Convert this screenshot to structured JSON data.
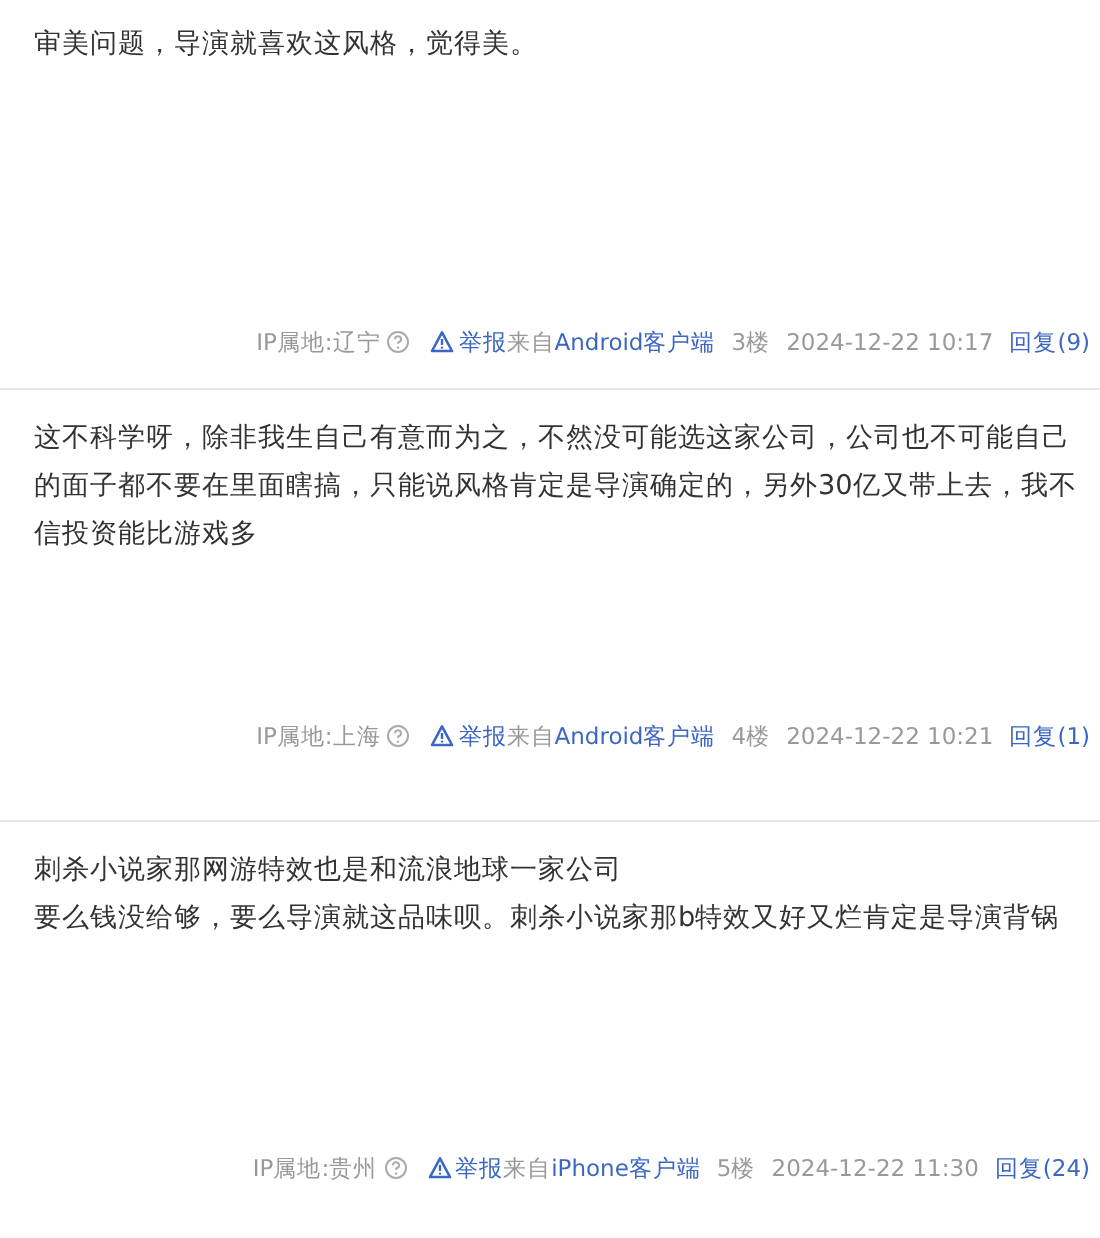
{
  "posts": [
    {
      "lines": [
        "审美问题，导演就喜欢这风格，觉得美。"
      ],
      "ip": "IP属地:辽宁",
      "report": "举报",
      "from_prefix": "来自",
      "client": "Android客户端",
      "floor": "3楼",
      "time": "2024-12-22 10:17",
      "reply": "回复(9)"
    },
    {
      "lines": [
        "这不科学呀，除非我生自己有意而为之，不然没可能选这家公司，公司也不可能自己的面子都不要在里面瞎搞，只能说风格肯定是导演确定的，另外30亿又带上去，我不信投资能比游戏多"
      ],
      "ip": "IP属地:上海",
      "report": "举报",
      "from_prefix": "来自",
      "client": "Android客户端",
      "floor": "4楼",
      "time": "2024-12-22 10:21",
      "reply": "回复(1)"
    },
    {
      "lines": [
        "刺杀小说家那网游特效也是和流浪地球一家公司",
        "要么钱没给够，要么导演就这品味呗。刺杀小说家那b特效又好又烂肯定是导演背锅"
      ],
      "ip": "IP属地:贵州",
      "report": "举报",
      "from_prefix": "来自",
      "client": "iPhone客户端",
      "floor": "5楼",
      "time": "2024-12-22 11:30",
      "reply": "回复(24)"
    }
  ]
}
